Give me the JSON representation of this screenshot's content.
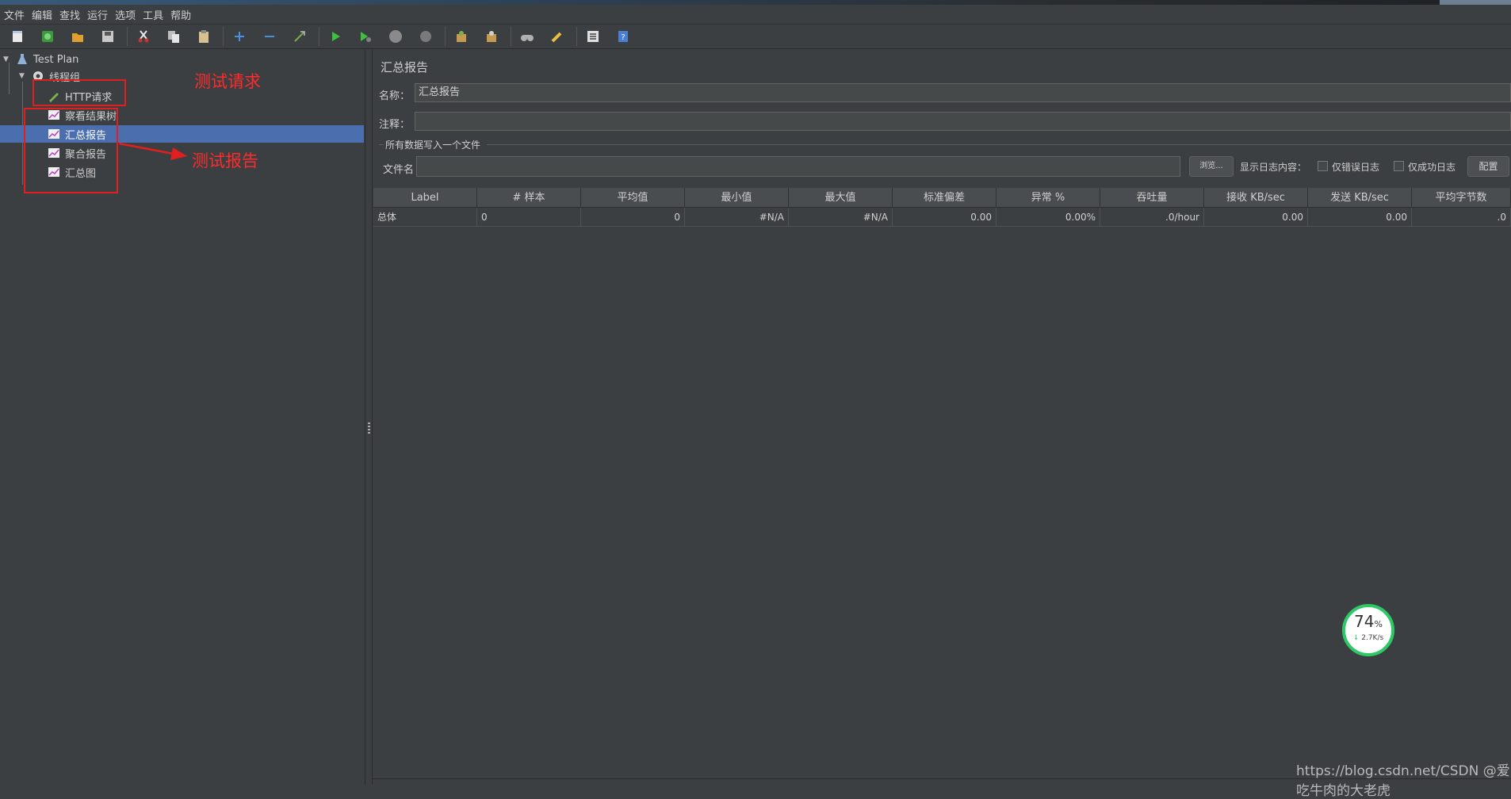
{
  "menu": [
    "文件",
    "编辑",
    "查找",
    "运行",
    "选项",
    "工具",
    "帮助"
  ],
  "toolbar": {
    "buttons": [
      {
        "name": "new-icon",
        "color": "#e8e8e8"
      },
      {
        "name": "templates-icon",
        "color": "#3a9b3a"
      },
      {
        "name": "open-icon",
        "color": "#e0a030"
      },
      {
        "name": "save-icon",
        "color": "#c8c8c8"
      },
      {
        "name": "cut-icon",
        "color": "#d03030"
      },
      {
        "name": "copy-icon",
        "color": "#d8d8d8"
      },
      {
        "name": "paste-icon",
        "color": "#d8c090"
      },
      {
        "name": "expand-icon",
        "color": "#4a90e2"
      },
      {
        "name": "collapse-icon",
        "color": "#4a90e2"
      },
      {
        "name": "toggle-icon",
        "color": "#7ab050"
      },
      {
        "name": "start-icon",
        "color": "#3fbf3f"
      },
      {
        "name": "start-no-pause-icon",
        "color": "#3fbf3f"
      },
      {
        "name": "stop-icon",
        "color": "#8a8a8a"
      },
      {
        "name": "shutdown-icon",
        "color": "#7a7a7a"
      },
      {
        "name": "clear-icon",
        "color": "#c89a50"
      },
      {
        "name": "clear-all-icon",
        "color": "#c89a50"
      },
      {
        "name": "search-icon",
        "color": "#b0b0b0"
      },
      {
        "name": "reset-search-icon",
        "color": "#e8c040"
      },
      {
        "name": "function-helper-icon",
        "color": "#e0e0e0"
      },
      {
        "name": "help-icon",
        "color": "#4a7ed0"
      }
    ]
  },
  "tree": {
    "test_plan": "Test Plan",
    "thread_group": "线程组",
    "items": [
      {
        "label": "HTTP请求",
        "icon": "pencil-icon"
      },
      {
        "label": "察看结果树",
        "icon": "chart-icon"
      },
      {
        "label": "汇总报告",
        "icon": "chart-icon",
        "selected": true
      },
      {
        "label": "聚合报告",
        "icon": "chart-icon"
      },
      {
        "label": "汇总图",
        "icon": "chart-icon"
      }
    ]
  },
  "annotations": {
    "request_label": "测试请求",
    "report_label": "测试报告",
    "color": "#ff2b2b"
  },
  "panel": {
    "title": "汇总报告",
    "name_label": "名称：",
    "name_value": "汇总报告",
    "comment_label": "注释：",
    "comment_value": "",
    "file_group_label": "所有数据写入一个文件",
    "filename_label": "文件名",
    "filename_value": "",
    "browse_button": "浏览...",
    "log_content_label": "显示日志内容：",
    "errors_only_label": "仅错误日志",
    "success_only_label": "仅成功日志",
    "configure_button": "配置"
  },
  "table": {
    "headers": [
      "Label",
      "# 样本",
      "平均值",
      "最小值",
      "最大值",
      "标准偏差",
      "异常 %",
      "吞吐量",
      "接收 KB/sec",
      "发送 KB/sec",
      "平均字节数"
    ],
    "rows": [
      [
        "总体",
        "0",
        "0",
        "#N/A",
        "#N/A",
        "0.00",
        "0.00%",
        ".0/hour",
        "0.00",
        "0.00",
        ".0"
      ]
    ]
  },
  "net_widget": {
    "percent": "74",
    "percent_unit": "%",
    "speed": "2.7K/s"
  },
  "watermark": "https://blog.csdn.net/CSDN @爱吃牛肉的大老虎"
}
